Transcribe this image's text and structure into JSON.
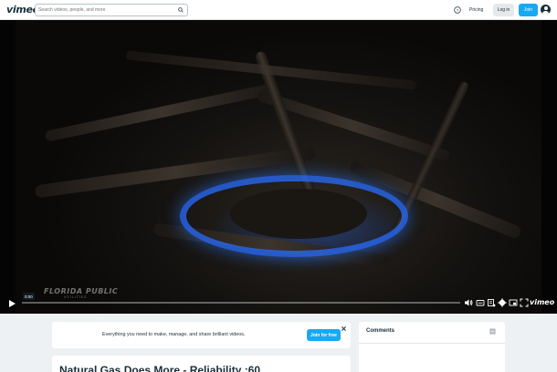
{
  "header": {
    "logo": "vimeo",
    "search_placeholder": "Search videos, people, and more",
    "pricing_label": "Pricing",
    "login_label": "Log in",
    "join_label": "Join"
  },
  "player": {
    "watermark": "FLORIDA PUBLIC",
    "watermark_sub": "UTILITIES",
    "timecode": "0:00",
    "progress": 0,
    "brand_mark": "vimeo",
    "accent_color": "#17a9f2"
  },
  "promo": {
    "text": "Everything you need to make, manage, and share brilliant videos.",
    "button_label": "Join for free"
  },
  "video": {
    "title": "Natural Gas Does More - Reliability :60"
  },
  "comments": {
    "title": "Comments"
  }
}
